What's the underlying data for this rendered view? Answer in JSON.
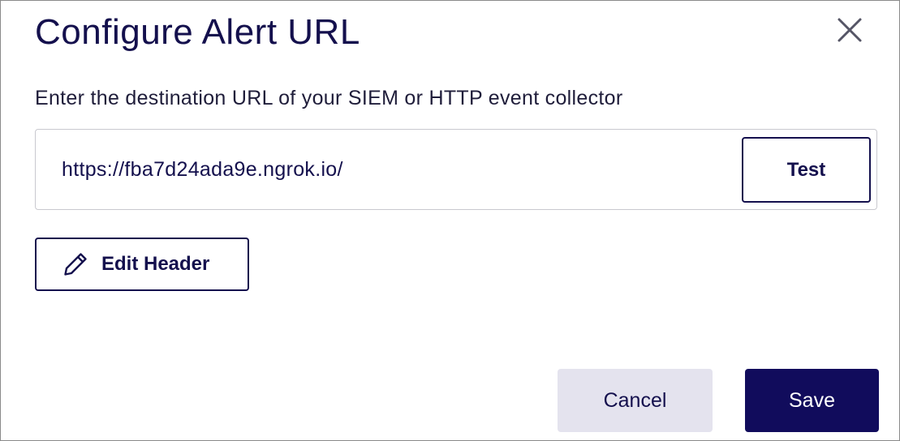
{
  "dialog": {
    "title": "Configure Alert URL",
    "close_icon": "close-icon",
    "description": "Enter the destination URL of your SIEM or HTTP event collector"
  },
  "url_field": {
    "value": "https://fba7d24ada9e.ngrok.io/",
    "test_label": "Test"
  },
  "edit_header": {
    "icon": "pencil-icon",
    "label": "Edit Header"
  },
  "footer": {
    "cancel_label": "Cancel",
    "save_label": "Save"
  },
  "colors": {
    "text_primary": "#14104d",
    "primary_button": "#110c5c",
    "secondary_button": "#e4e3ee",
    "border": "#c9c9cf"
  }
}
